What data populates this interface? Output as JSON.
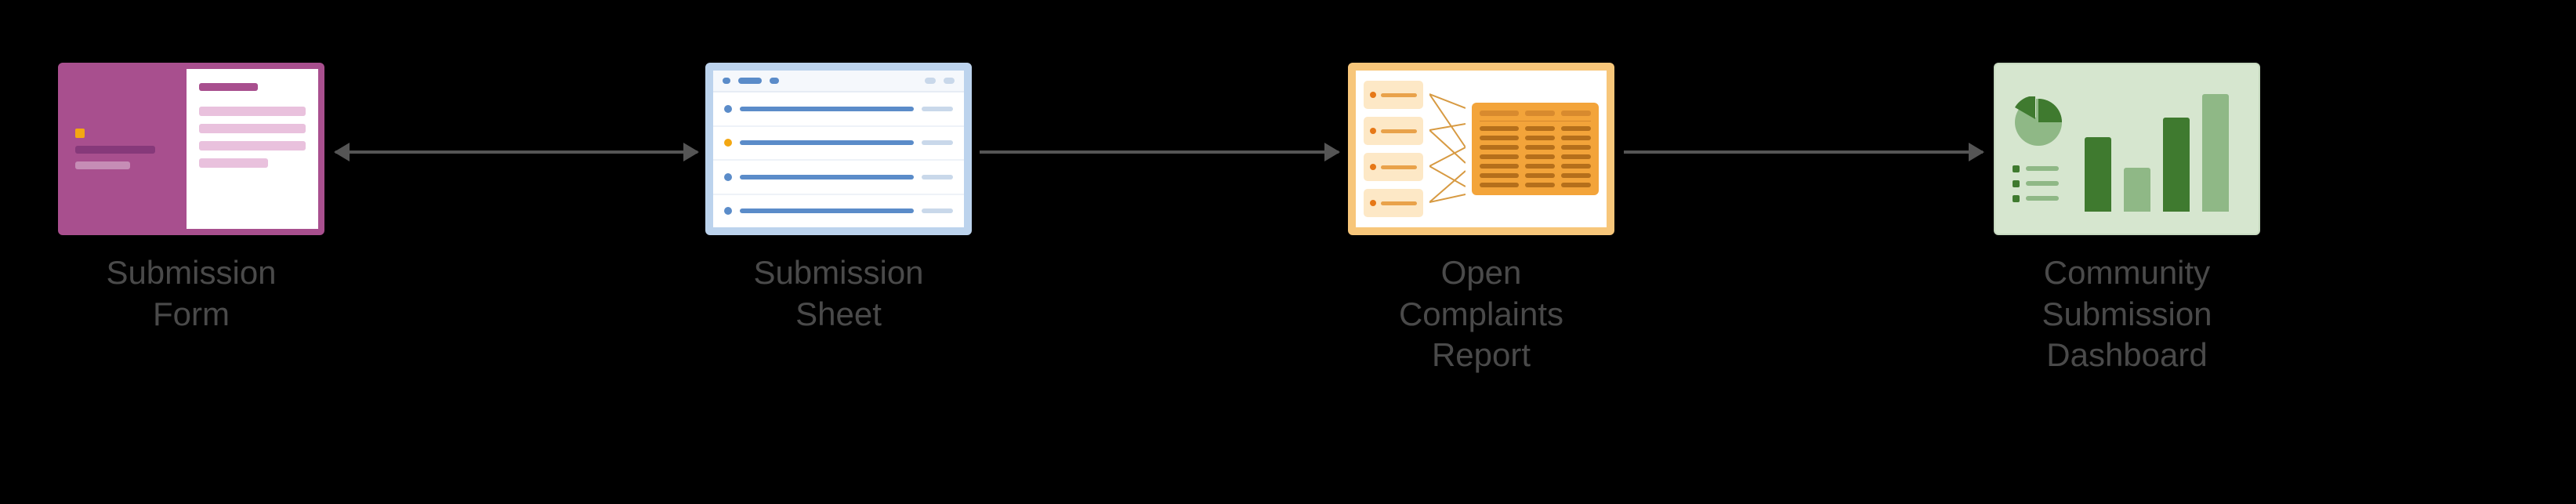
{
  "diagram": {
    "nodes": [
      {
        "id": "submission-form",
        "label": "Submission\nForm"
      },
      {
        "id": "submission-sheet",
        "label": "Submission\nSheet"
      },
      {
        "id": "open-complaints-report",
        "label": "Open\nComplaints\nReport"
      },
      {
        "id": "community-submission-dashboard",
        "label": "Community\nSubmission\nDashboard"
      }
    ],
    "edges": [
      {
        "from": "submission-form",
        "to": "submission-sheet",
        "direction": "bidirectional"
      },
      {
        "from": "submission-sheet",
        "to": "open-complaints-report",
        "direction": "forward"
      },
      {
        "from": "open-complaints-report",
        "to": "community-submission-dashboard",
        "direction": "forward"
      }
    ]
  }
}
